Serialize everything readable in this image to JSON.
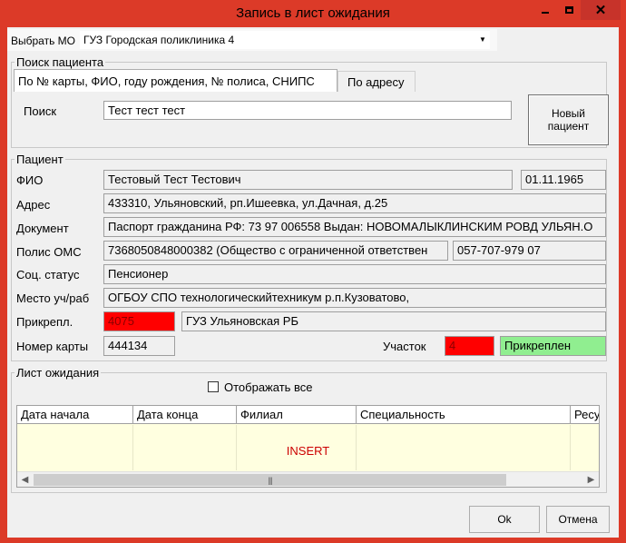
{
  "window": {
    "title": "Запись в лист ожидания",
    "close_glyph": "✕"
  },
  "mo": {
    "label": "Выбрать МО",
    "value": "ГУЗ Городская поликлиника 4"
  },
  "search": {
    "group_title": "Поиск пациента",
    "tab_card": "По № карты, ФИО, году рождения, № полиса, СНИПС",
    "tab_address": "По адресу",
    "label": "Поиск",
    "value": "Тест тест тест",
    "new_patient_line1": "Новый",
    "new_patient_line2": "пациент"
  },
  "patient": {
    "group_title": "Пациент",
    "fio_label": "ФИО",
    "fio": "Тестовый Тест Тестович",
    "birth_date": "01.11.1965",
    "address_label": "Адрес",
    "address": "433310, Ульяновский, рп.Ишеевка, ул.Дачная, д.25",
    "document_label": "Документ",
    "document": "Паспорт гражданина РФ: 73 97 006558 Выдан: НОВОМАЛЫКЛИНСКИМ  РОВД УЛЬЯН.О",
    "policy_label": "Полис ОМС",
    "policy": "7368050848000382 (Общество с ограниченной ответствен",
    "snils": "057-707-979 07",
    "social_label": "Соц. статус",
    "social": "Пенсионер",
    "work_label": "Место уч/раб",
    "work": "ОГБОУ СПО технологическийтехникум р.п.Кузоватово,",
    "attach_label": "Прикрепл.",
    "attach_code": "4075",
    "attach_org": "ГУЗ Ульяновская РБ",
    "card_label": "Номер карты",
    "card": "444134",
    "district_label": "Участок",
    "district": "4",
    "status": "Прикреплен"
  },
  "waitlist": {
    "group_title": "Лист ожидания",
    "show_all_label": "Отображать все",
    "show_all_checked": false,
    "columns": [
      "Дата начала",
      "Дата конца",
      "Филиал",
      "Специальность",
      "Ресу"
    ],
    "insert_text": "INSERT"
  },
  "buttons": {
    "ok": "Ok",
    "cancel": "Отмена"
  },
  "colors": {
    "title_bar": "#dc3a28",
    "attach_highlight": "#ff0000",
    "status_ok": "#90ee90",
    "grid_background": "#ffffe0"
  }
}
